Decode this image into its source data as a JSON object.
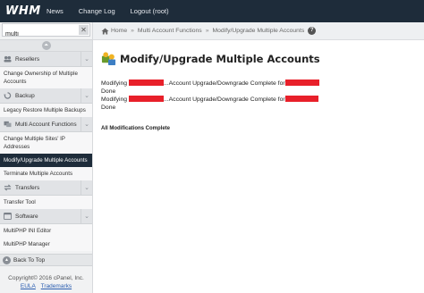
{
  "topbar": {
    "logo": "WHM",
    "nav": [
      "News",
      "Change Log",
      "Logout (root)"
    ]
  },
  "sidebar": {
    "search": {
      "value": "multi",
      "placeholder": ""
    },
    "clear_label": "✕",
    "collapse_label": "⏶",
    "sections": [
      {
        "title": "Resellers",
        "icon": "resellers-icon",
        "items": [
          "Change Ownership of Multiple Accounts"
        ]
      },
      {
        "title": "Backup",
        "icon": "backup-icon",
        "items": [
          "Legacy Restore Multiple Backups"
        ]
      },
      {
        "title": "Multi Account Functions",
        "icon": "multi-account-icon",
        "items": [
          "Change Multiple Sites' IP Addresses",
          "Modify/Upgrade Multiple Accounts",
          "Terminate Multiple Accounts"
        ],
        "active": "Modify/Upgrade Multiple Accounts"
      },
      {
        "title": "Transfers",
        "icon": "transfers-icon",
        "items": [
          "Transfer Tool"
        ]
      },
      {
        "title": "Software",
        "icon": "software-icon",
        "items": [
          "MultiPHP INI Editor",
          "MultiPHP Manager"
        ]
      }
    ],
    "back_to_top": "Back To Top",
    "footer": {
      "copyright": "Copyright© 2016 cPanel, Inc.",
      "links": [
        "EULA",
        "Trademarks"
      ]
    }
  },
  "breadcrumb": {
    "items": [
      "Home",
      "Multi Account Functions",
      "Modify/Upgrade Multiple Accounts"
    ],
    "help_label": "?"
  },
  "main": {
    "title": "Modify/Upgrade Multiple Accounts",
    "lines": [
      {
        "prefix": "Modifying",
        "middle": "...Account Upgrade/Downgrade Complete for",
        "status": "Done"
      },
      {
        "prefix": "Modifying",
        "middle": "...Account Upgrade/Downgrade Complete for",
        "status": "Done"
      }
    ],
    "summary": "All Modifications Complete"
  },
  "colors": {
    "topbar": "#1e2c3a",
    "active": "#1e2c3a",
    "redaction": "#e8202a",
    "link": "#2a5db0"
  }
}
